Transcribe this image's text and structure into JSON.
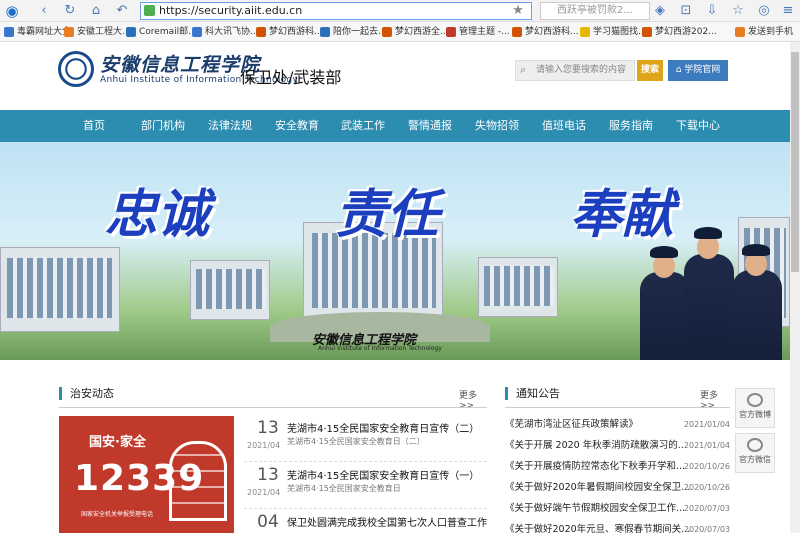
{
  "browser": {
    "url": "https://security.aiit.edu.cn",
    "search_text": "西跃亭被罚款2..."
  },
  "bookmarks": [
    {
      "label": "毒霸网址大全",
      "color": "#3a76d0"
    },
    {
      "label": "安徽工程大...",
      "color": "#e67e22"
    },
    {
      "label": "Coremail邮...",
      "color": "#2c6fbb"
    },
    {
      "label": "科大讯飞协...",
      "color": "#3a76d0"
    },
    {
      "label": "梦幻西游科...",
      "color": "#d35400"
    },
    {
      "label": "陪你一起去...",
      "color": "#2c6fbb"
    },
    {
      "label": "梦幻西游全...",
      "color": "#d35400"
    },
    {
      "label": "管理主题 -...",
      "color": "#c0392b"
    },
    {
      "label": "梦幻西游科...",
      "color": "#d35400"
    },
    {
      "label": "学习猫图找...",
      "color": "#e6b800"
    },
    {
      "label": "梦幻西游202...",
      "color": "#d35400"
    },
    {
      "label": "发送到手机",
      "color": "#e67e22"
    }
  ],
  "header": {
    "school_name_cn": "安徽信息工程学院",
    "school_name_en": "Anhui Institute of Information Technology",
    "department": "保卫处/武装部",
    "search_placeholder": "请输入您要搜索的内容",
    "search_button": "搜索",
    "portal_button": "学院官网"
  },
  "nav": [
    "首页",
    "部门机构",
    "法律法规",
    "安全教育",
    "武装工作",
    "警情通报",
    "失物招领",
    "值班电话",
    "服务指南",
    "下载中心"
  ],
  "banner": {
    "slogans": [
      "忠诚",
      "责任",
      "奉献"
    ],
    "school_name_cn": "安徽信息工程学院",
    "school_name_en": "Anhui Institute of Information Technology"
  },
  "security_news": {
    "title": "治安动态",
    "more": "更多>>",
    "image": {
      "title": "国安·家全",
      "number": "12339",
      "caption": "国家安全机关举报受理电话"
    },
    "items": [
      {
        "day": "13",
        "ym": "2021/04",
        "title": "芜湖市4·15全民国家安全教育日宣传（二）",
        "summary": "芜湖市4·15全民国家安全教育日（二）"
      },
      {
        "day": "13",
        "ym": "2021/04",
        "title": "芜湖市4·15全民国家安全教育日宣传（一）",
        "summary": "芜湖市4·15全民国家安全教育日"
      },
      {
        "day": "04",
        "ym": "",
        "title": "保卫处圆满完成我校全国第七次人口普查工作",
        "summary": ""
      }
    ]
  },
  "notices": {
    "title": "通知公告",
    "more": "更多>>",
    "items": [
      {
        "title": "《芜湖市湾沚区征兵政策解读》",
        "date": "2021/01/04"
      },
      {
        "title": "《关于开展 2020 年秋季消防疏散演习的...",
        "date": "2021/01/04"
      },
      {
        "title": "《关于开展疫情防控常态化下秋季开学和...",
        "date": "2020/10/26"
      },
      {
        "title": "《关于做好2020年暑假期间校园安全保卫...",
        "date": "2020/10/26"
      },
      {
        "title": "《关于做好端午节假期校园安全保卫工作...",
        "date": "2020/07/03"
      },
      {
        "title": "《关于做好2020年元旦、寒假春节期间关...",
        "date": "2020/07/03"
      }
    ]
  },
  "side": {
    "weibo": "官方微博",
    "wechat": "官方微信"
  }
}
